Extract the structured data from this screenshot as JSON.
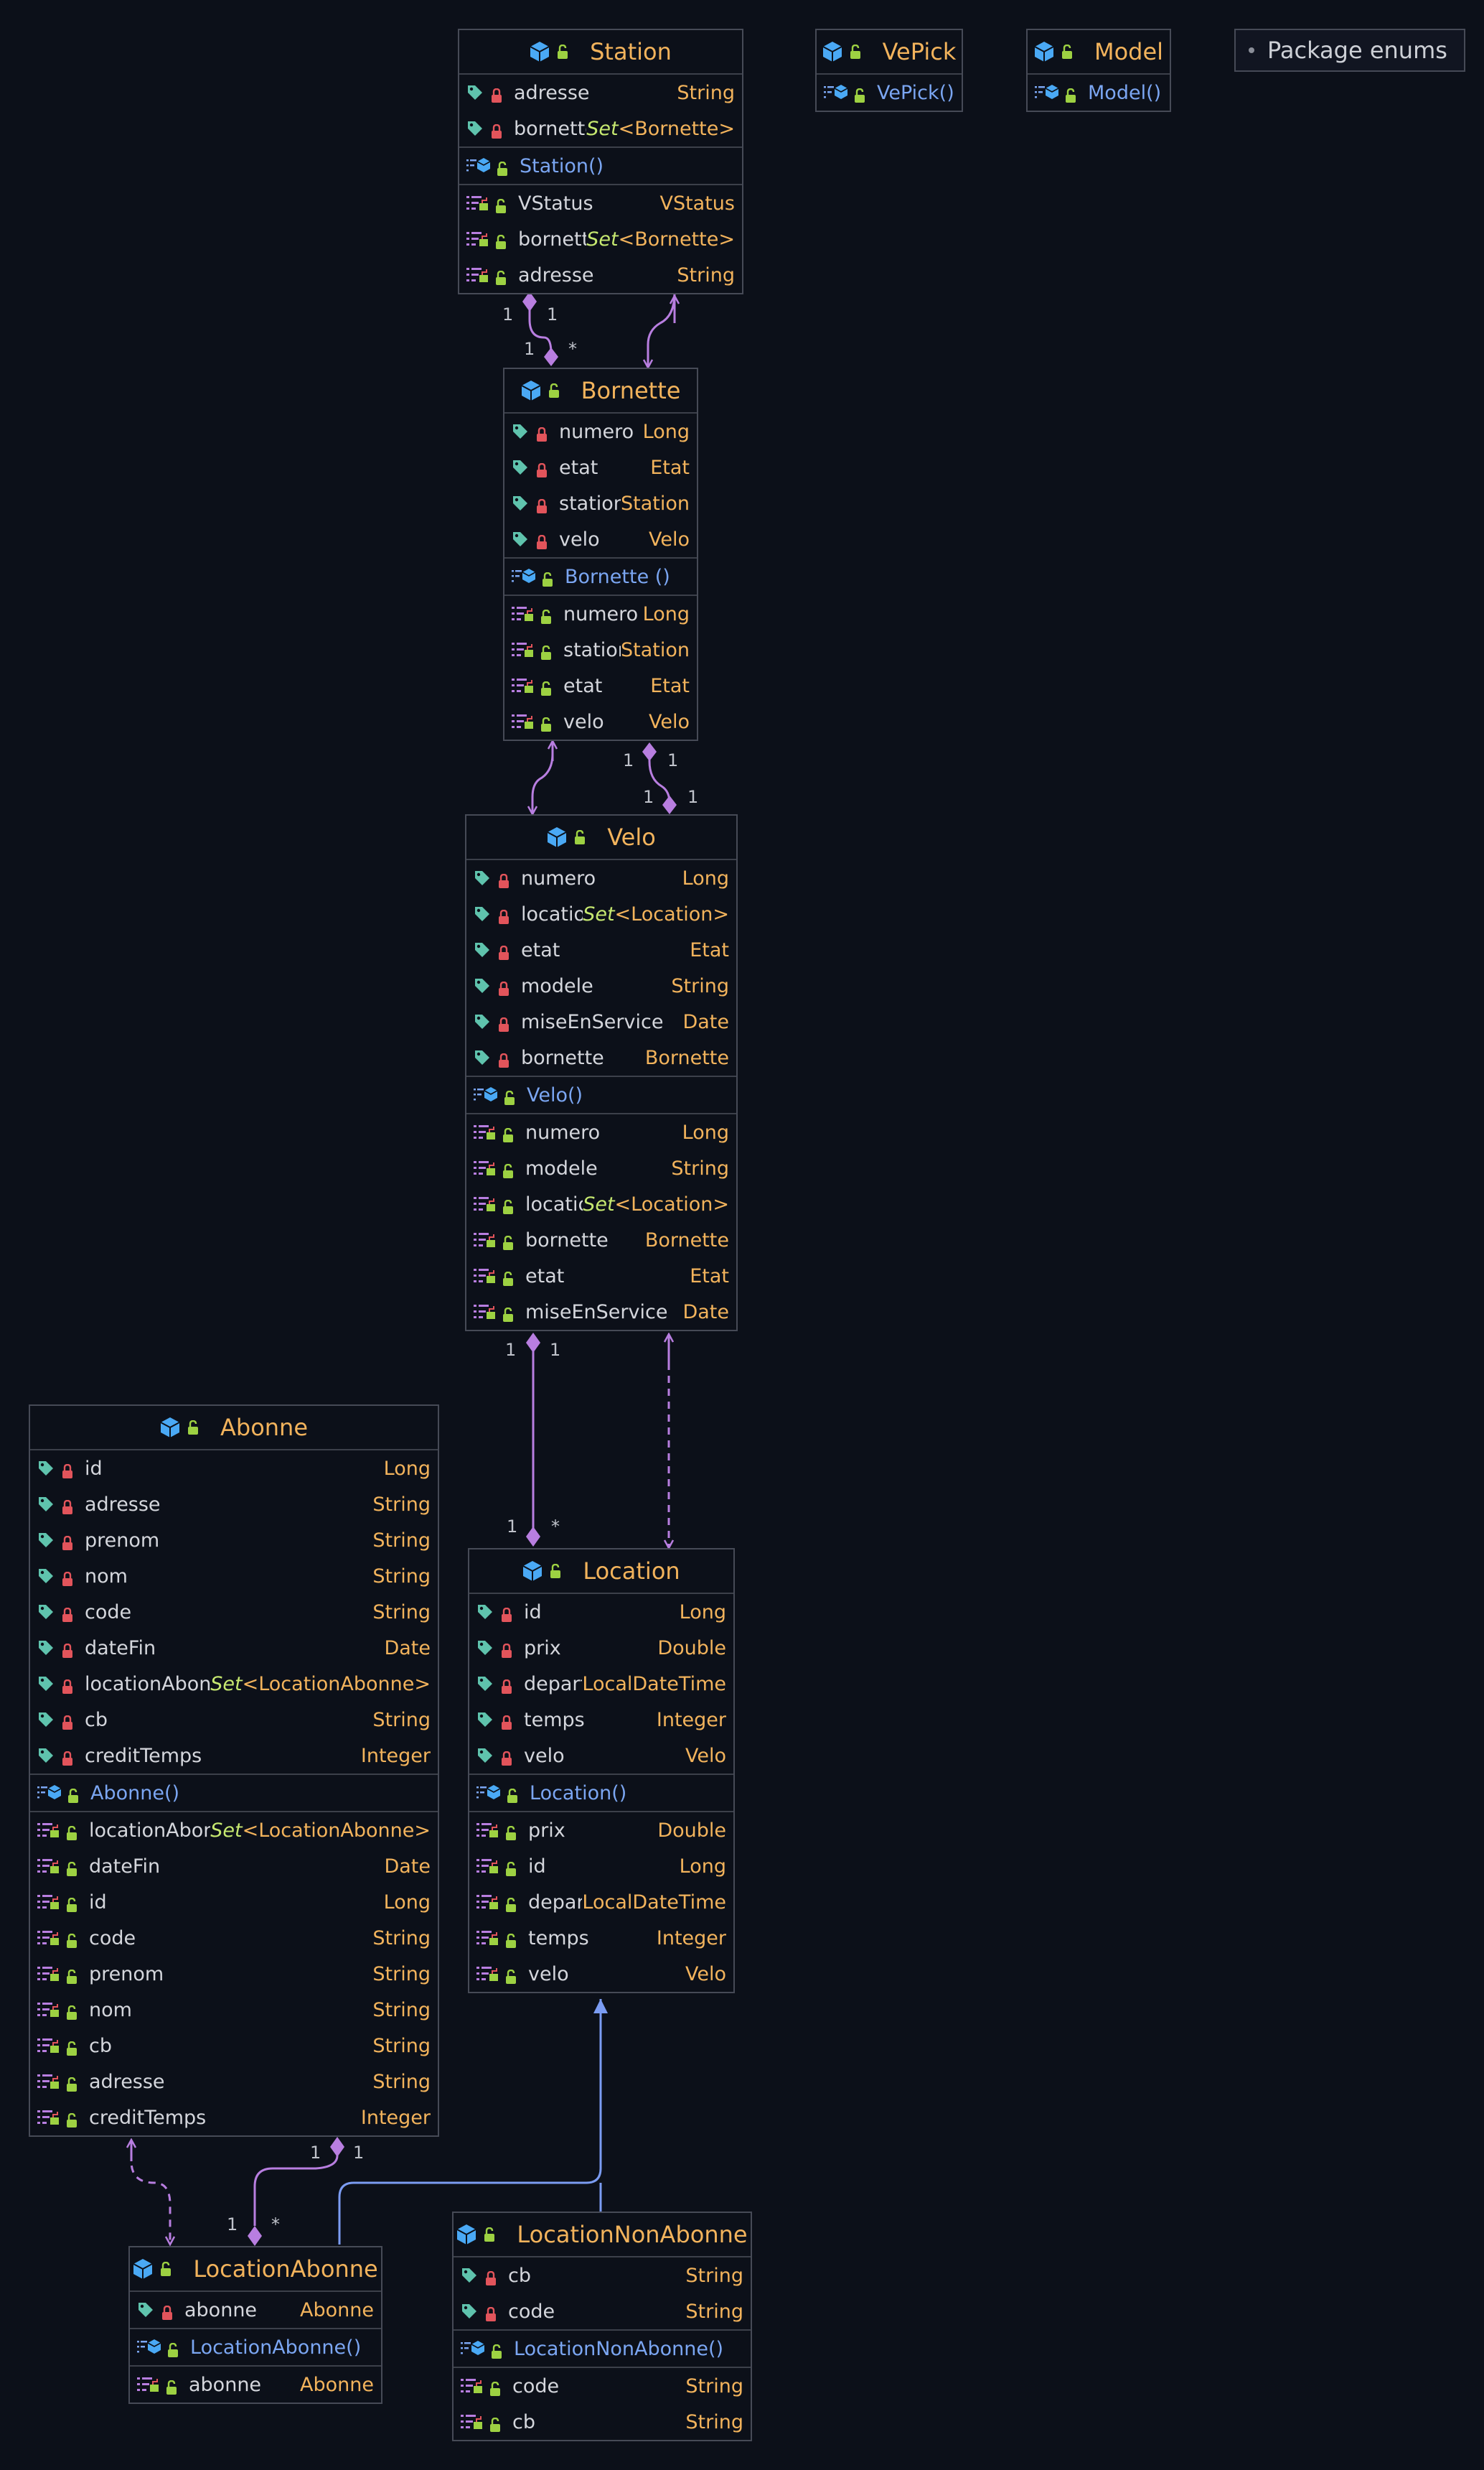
{
  "package": {
    "label": "Package enums"
  },
  "colors": {
    "background": "#0c1019",
    "class_name": "#f2b35c",
    "type": "#f2b35c",
    "generic": "#c6e870",
    "constructor": "#7ba6f2",
    "association": "#b87ee0",
    "inheritance": "#7b9cf2",
    "tag_icon": "#5fc3ad",
    "lock_icon": "#e2545b",
    "unlock_icon": "#9dd142",
    "cube_icon": "#4aa9f5"
  },
  "classes": {
    "station": {
      "name": "Station",
      "fields": [
        {
          "name": "adresse",
          "type": "String"
        },
        {
          "name": "bornettes",
          "type": "Set<Bornette>"
        }
      ],
      "constructors": [
        {
          "name": "Station()"
        }
      ],
      "properties": [
        {
          "name": "VStatus",
          "type": "VStatus"
        },
        {
          "name": "bornettes",
          "type": "Set<Bornette>"
        },
        {
          "name": "adresse",
          "type": "String"
        }
      ]
    },
    "vepick": {
      "name": "VePick",
      "fields": [],
      "constructors": [
        {
          "name": "VePick()"
        }
      ],
      "properties": []
    },
    "model": {
      "name": "Model",
      "fields": [],
      "constructors": [
        {
          "name": "Model()"
        }
      ],
      "properties": []
    },
    "bornette": {
      "name": "Bornette",
      "fields": [
        {
          "name": "numero",
          "type": "Long"
        },
        {
          "name": "etat",
          "type": "Etat"
        },
        {
          "name": "station",
          "type": "Station"
        },
        {
          "name": "velo",
          "type": "Velo"
        }
      ],
      "constructors": [
        {
          "name": "Bornette ()"
        }
      ],
      "properties": [
        {
          "name": "numero",
          "type": "Long"
        },
        {
          "name": "station",
          "type": "Station"
        },
        {
          "name": "etat",
          "type": "Etat"
        },
        {
          "name": "velo",
          "type": "Velo"
        }
      ]
    },
    "velo": {
      "name": "Velo",
      "fields": [
        {
          "name": "numero",
          "type": "Long"
        },
        {
          "name": "locations",
          "type": "Set<Location>"
        },
        {
          "name": "etat",
          "type": "Etat"
        },
        {
          "name": "modele",
          "type": "String"
        },
        {
          "name": "miseEnService",
          "type": "Date"
        },
        {
          "name": "bornette",
          "type": "Bornette"
        }
      ],
      "constructors": [
        {
          "name": "Velo()"
        }
      ],
      "properties": [
        {
          "name": "numero",
          "type": "Long"
        },
        {
          "name": "modele",
          "type": "String"
        },
        {
          "name": "locations",
          "type": "Set<Location>"
        },
        {
          "name": "bornette",
          "type": "Bornette"
        },
        {
          "name": "etat",
          "type": "Etat"
        },
        {
          "name": "miseEnService",
          "type": "Date"
        }
      ]
    },
    "abonne": {
      "name": "Abonne",
      "fields": [
        {
          "name": "id",
          "type": "Long"
        },
        {
          "name": "adresse",
          "type": "String"
        },
        {
          "name": "prenom",
          "type": "String"
        },
        {
          "name": "nom",
          "type": "String"
        },
        {
          "name": "code",
          "type": "String"
        },
        {
          "name": "dateFin",
          "type": "Date"
        },
        {
          "name": "locationAbonnes",
          "type": "Set<LocationAbonne>"
        },
        {
          "name": "cb",
          "type": "String"
        },
        {
          "name": "creditTemps",
          "type": "Integer"
        }
      ],
      "constructors": [
        {
          "name": "Abonne()"
        }
      ],
      "properties": [
        {
          "name": "locationAbonnes",
          "type": "Set<LocationAbonne>"
        },
        {
          "name": "dateFin",
          "type": "Date"
        },
        {
          "name": "id",
          "type": "Long"
        },
        {
          "name": "code",
          "type": "String"
        },
        {
          "name": "prenom",
          "type": "String"
        },
        {
          "name": "nom",
          "type": "String"
        },
        {
          "name": "cb",
          "type": "String"
        },
        {
          "name": "adresse",
          "type": "String"
        },
        {
          "name": "creditTemps",
          "type": "Integer"
        }
      ]
    },
    "location": {
      "name": "Location",
      "fields": [
        {
          "name": "id",
          "type": "Long"
        },
        {
          "name": "prix",
          "type": "Double"
        },
        {
          "name": "depart",
          "type": "LocalDateTime"
        },
        {
          "name": "temps",
          "type": "Integer"
        },
        {
          "name": "velo",
          "type": "Velo"
        }
      ],
      "constructors": [
        {
          "name": "Location()"
        }
      ],
      "properties": [
        {
          "name": "prix",
          "type": "Double"
        },
        {
          "name": "id",
          "type": "Long"
        },
        {
          "name": "depart",
          "type": "LocalDateTime"
        },
        {
          "name": "temps",
          "type": "Integer"
        },
        {
          "name": "velo",
          "type": "Velo"
        }
      ]
    },
    "locationAbonne": {
      "name": "LocationAbonne",
      "fields": [
        {
          "name": "abonne",
          "type": "Abonne"
        }
      ],
      "constructors": [
        {
          "name": "LocationAbonne()"
        }
      ],
      "properties": [
        {
          "name": "abonne",
          "type": "Abonne"
        }
      ]
    },
    "locationNonAbonne": {
      "name": "LocationNonAbonne",
      "fields": [
        {
          "name": "cb",
          "type": "String"
        },
        {
          "name": "code",
          "type": "String"
        }
      ],
      "constructors": [
        {
          "name": "LocationNonAbonne()"
        }
      ],
      "properties": [
        {
          "name": "code",
          "type": "String"
        },
        {
          "name": "cb",
          "type": "String"
        }
      ]
    }
  },
  "multiplicities": {
    "station_bornette": [
      "1",
      "1",
      "1",
      "*"
    ],
    "bornette_velo": [
      "1",
      "1",
      "1",
      "1"
    ],
    "velo_location": [
      "1",
      "1",
      "1",
      "*"
    ],
    "abonne_locationAbonne": [
      "1",
      "1",
      "1",
      "*"
    ]
  }
}
